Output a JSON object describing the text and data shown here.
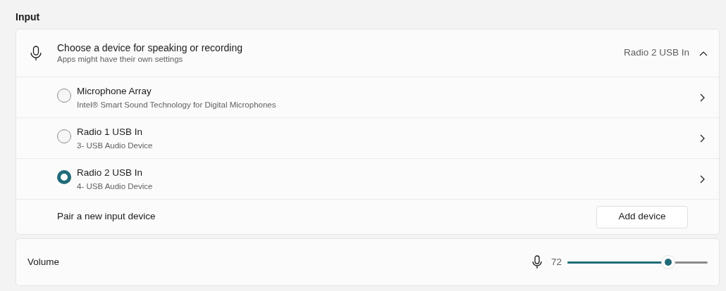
{
  "section_title": "Input",
  "device_picker": {
    "title": "Choose a device for speaking or recording",
    "subtitle": "Apps might have their own settings",
    "current": "Radio 2 USB In",
    "expanded": true,
    "devices": [
      {
        "name": "Microphone Array",
        "detail": "Intel® Smart Sound Technology for Digital Microphones",
        "selected": false
      },
      {
        "name": "Radio 1 USB In",
        "detail": "3- USB Audio Device",
        "selected": false
      },
      {
        "name": "Radio 2 USB In",
        "detail": "4- USB Audio Device",
        "selected": true
      }
    ],
    "pair_label": "Pair a new input device",
    "pair_button": "Add device"
  },
  "volume": {
    "label": "Volume",
    "reading": "72",
    "level": 0.72
  }
}
